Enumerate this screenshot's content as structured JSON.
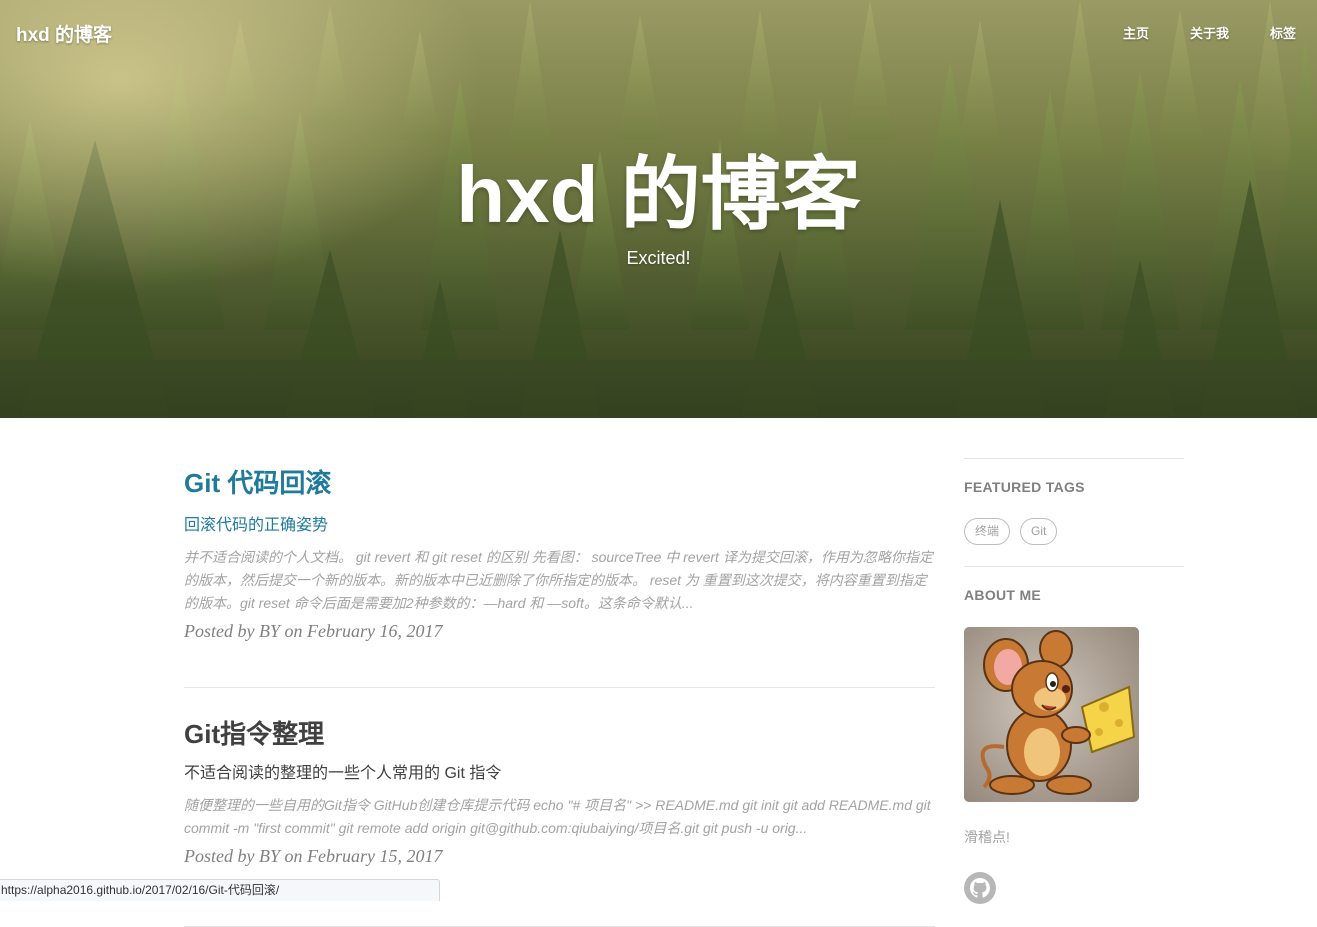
{
  "header": {
    "brand": "hxd 的博客",
    "nav": [
      {
        "label": "主页"
      },
      {
        "label": "关于我"
      },
      {
        "label": "标签"
      }
    ]
  },
  "hero": {
    "title": "hxd 的博客",
    "subtitle": "Excited!"
  },
  "posts": [
    {
      "title": "Git 代码回滚",
      "subtitle": "回滚代码的正确姿势",
      "excerpt": "并不适合阅读的个人文档。 git revert 和 git reset 的区别 先看图： sourceTree 中 revert 译为提交回滚，作用为忽略你指定的版本，然后提交一个新的版本。新的版本中已近删除了你所指定的版本。 reset 为 重置到这次提交，将内容重置到指定的版本。git reset 命令后面是需要加2种参数的：—hard 和 —soft。这条命令默认...",
      "meta": "Posted by BY on February 16, 2017"
    },
    {
      "title": "Git指令整理",
      "subtitle": "不适合阅读的整理的一些个人常用的 Git 指令",
      "excerpt": "随便整理的一些自用的Git指令 GitHub创建仓库提示代码 echo \"# 项目名\" >> README.md git init git add README.md git commit -m \"first commit\" git remote add origin git@github.com:qiubaiying/项目名.git git push -u orig...",
      "meta": "Posted by BY on February 15, 2017"
    }
  ],
  "sidebar": {
    "featured_tags_heading": "FEATURED TAGS",
    "tags": [
      {
        "label": "终端"
      },
      {
        "label": "Git"
      }
    ],
    "about_heading": "ABOUT ME",
    "about_text": "滑稽点!",
    "github_icon": "github-icon"
  },
  "statusbar": {
    "url": "https://alpha2016.github.io/2017/02/16/Git-代码回滚/"
  },
  "colors": {
    "link_active": "#1f7a9c",
    "text": "#404040",
    "muted": "#a3a3a3"
  }
}
